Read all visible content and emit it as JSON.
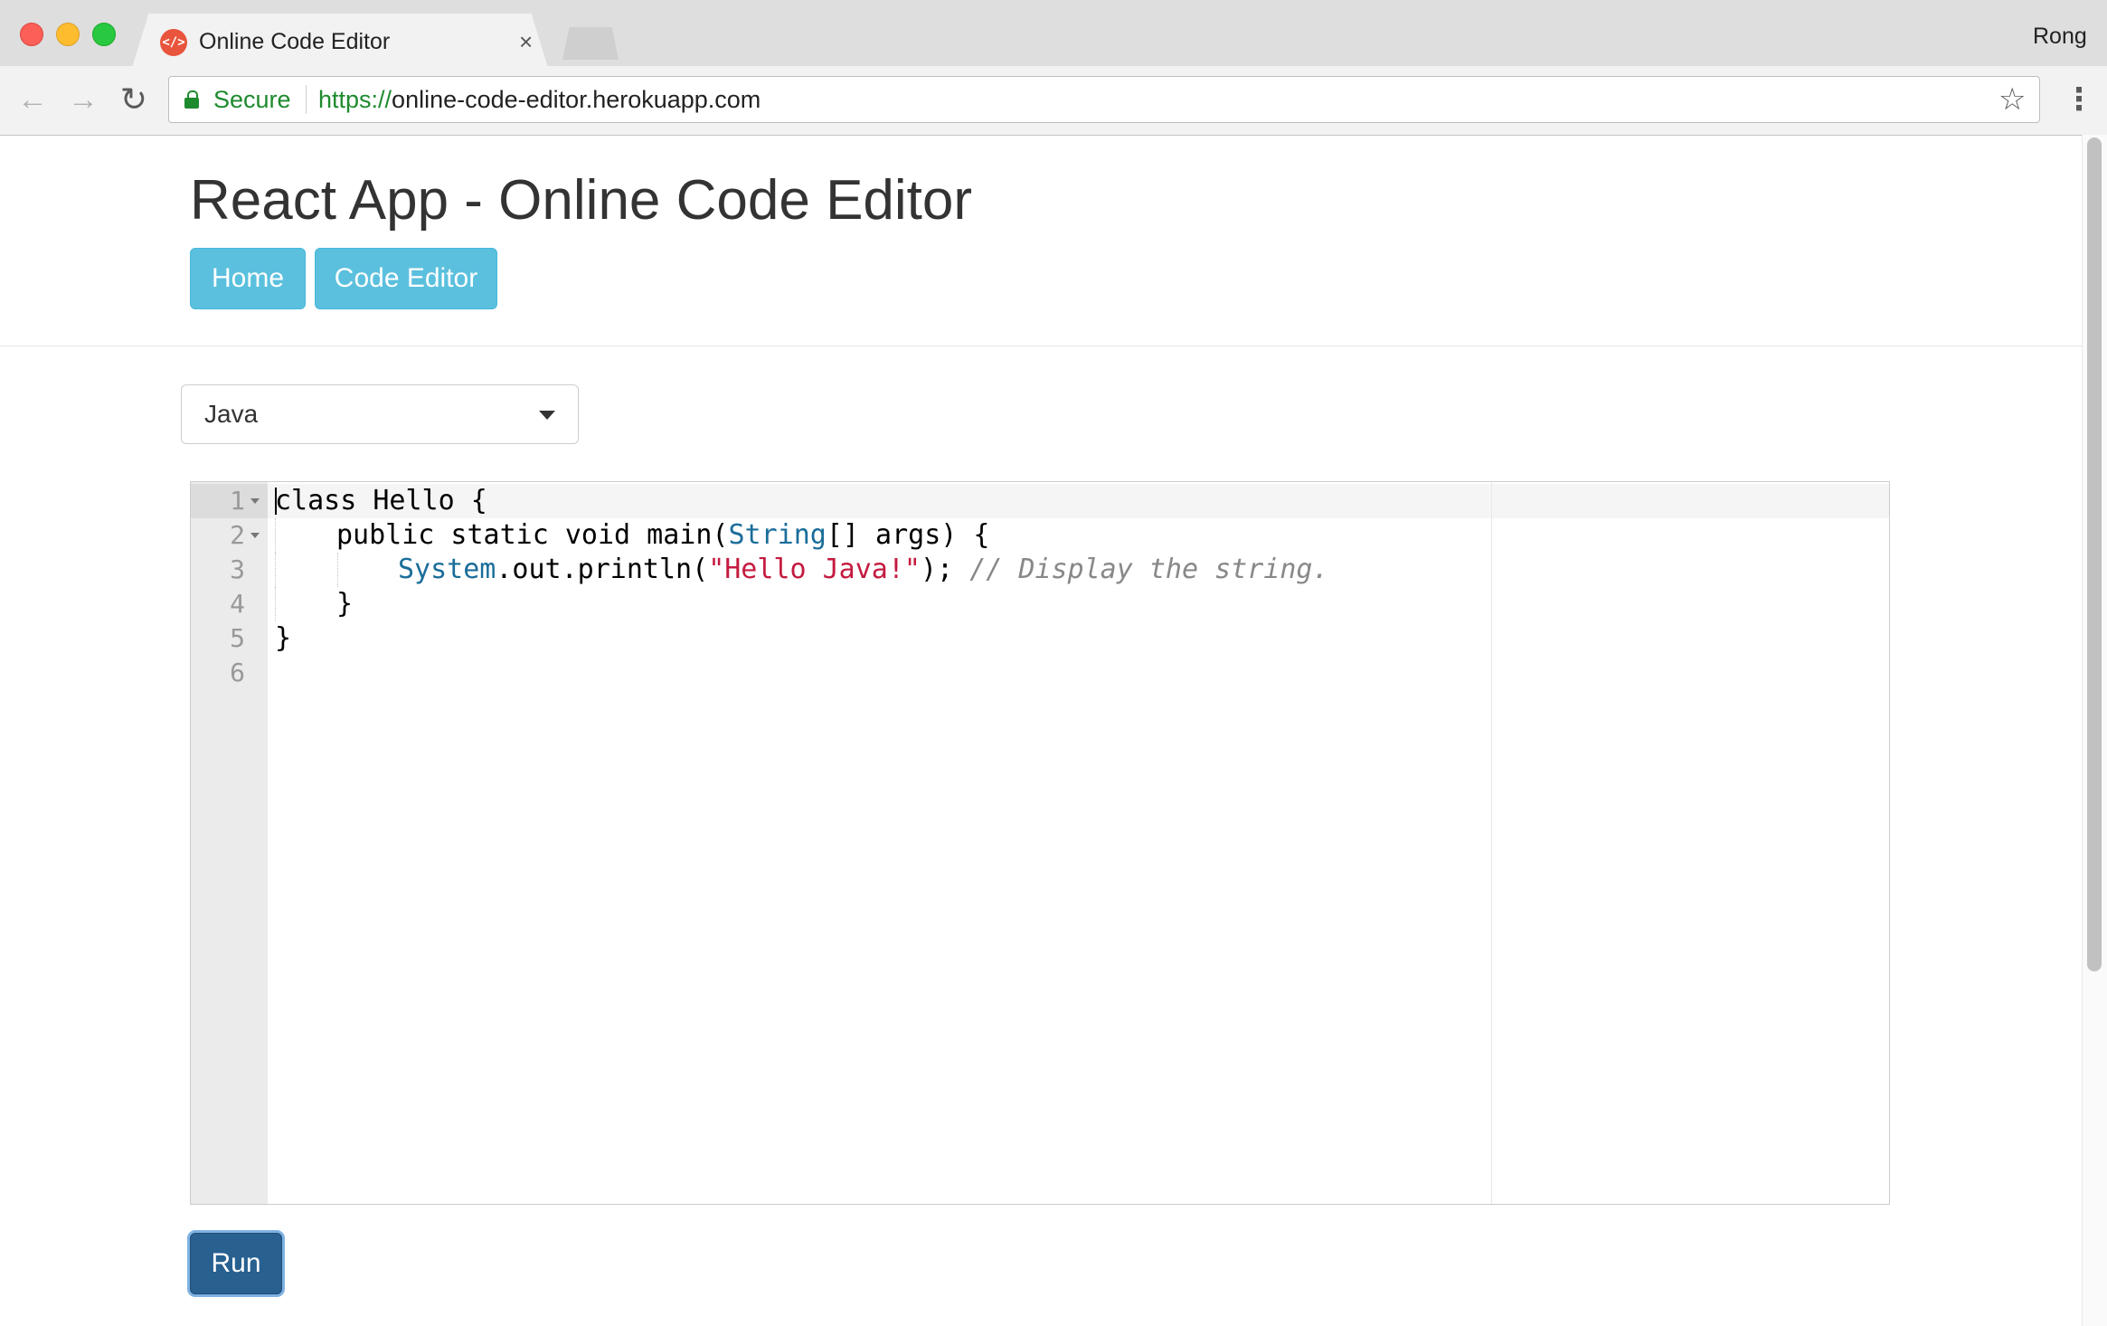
{
  "browser": {
    "tab_title": "Online Code Editor",
    "tab_favicon_text": "</>",
    "tab_close": "×",
    "profile_name": "Rong",
    "secure_label": "Secure",
    "url_scheme": "https://",
    "url_host": "online-code-editor.herokuapp.com",
    "icons": {
      "back": "←",
      "forward": "→",
      "reload": "↻",
      "bookmark": "☆",
      "menu": "⋮"
    }
  },
  "page": {
    "title": "React App - Online Code Editor",
    "nav": {
      "home_label": "Home",
      "code_editor_label": "Code Editor"
    },
    "language_select": {
      "selected": "Java"
    },
    "editor": {
      "line_numbers": [
        "1",
        "2",
        "3",
        "4",
        "5",
        "6"
      ],
      "lines": {
        "l1": "class Hello {",
        "l2_pre": "public static void main(",
        "l2_type": "String",
        "l2_post": "[] args) {",
        "l3_type": "System",
        "l3_mid": ".out.println(",
        "l3_str": "\"Hello Java!\"",
        "l3_end": ");",
        "l3_comment": "// Display the string.",
        "l4": "}",
        "l5": "}"
      }
    },
    "run_label": "Run"
  },
  "colors": {
    "nav_button": "#5bc0de",
    "run_button": "#286090",
    "secure_green": "#1e8a2e",
    "code_type": "#1a6d9a",
    "code_string": "#c41a3f",
    "code_comment": "#888888"
  }
}
